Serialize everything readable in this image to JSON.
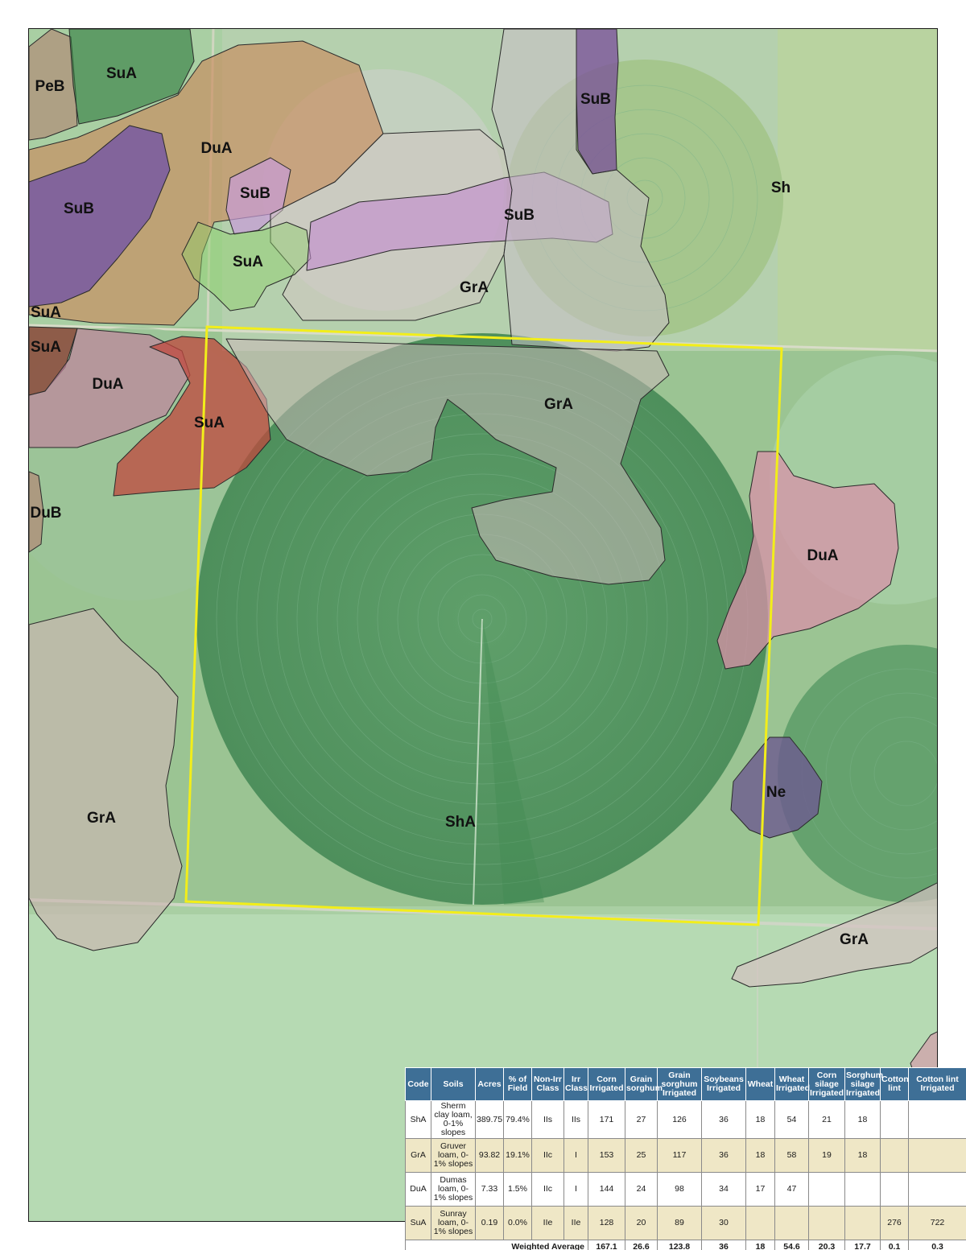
{
  "map": {
    "labels": [
      {
        "key": "PeB",
        "text": "PeB"
      },
      {
        "key": "SuA_1",
        "text": "SuA"
      },
      {
        "key": "SuB_1",
        "text": "SuB"
      },
      {
        "key": "DuA_1",
        "text": "DuA"
      },
      {
        "key": "SuB_2",
        "text": "SuB"
      },
      {
        "key": "SuB_3",
        "text": "SuB"
      },
      {
        "key": "Sh",
        "text": "Sh"
      },
      {
        "key": "SuB_4",
        "text": "SuB"
      },
      {
        "key": "SuA_2",
        "text": "SuA"
      },
      {
        "key": "GrA_1",
        "text": "GrA"
      },
      {
        "key": "SuA_3",
        "text": "SuA"
      },
      {
        "key": "SuA_4",
        "text": "SuA"
      },
      {
        "key": "DuA_2",
        "text": "DuA"
      },
      {
        "key": "SuA_5",
        "text": "SuA"
      },
      {
        "key": "GrA_2",
        "text": "GrA"
      },
      {
        "key": "DuB",
        "text": "DuB"
      },
      {
        "key": "DuA_3",
        "text": "DuA"
      },
      {
        "key": "Ne",
        "text": "Ne"
      },
      {
        "key": "GrA_3",
        "text": "GrA"
      },
      {
        "key": "ShA",
        "text": "ShA"
      },
      {
        "key": "GrA_4",
        "text": "GrA"
      }
    ],
    "colors": {
      "boundary": "#f2ee1a",
      "SuA": "#2f7a3e",
      "SuB": "#8a5aa0",
      "DuA": "#c98a5c",
      "DuA_pink": "#d892a8",
      "GrA": "#c9b8b0",
      "SuA_red": "#c0483e",
      "Ne": "#6d5a90",
      "ShA": "#4f9a5c",
      "PeB": "#b0907a"
    }
  },
  "table": {
    "headers": [
      "Code",
      "Soils",
      "Acres",
      "% of Field",
      "Non-Irr Class",
      "Irr Class",
      "Corn Irrigated",
      "Grain sorghum",
      "Grain sorghum Irrigated",
      "Soybeans Irrigated",
      "Wheat",
      "Wheat Irrigated",
      "Corn silage Irrigated",
      "Sorghum silage Irrigated",
      "Cotton lint",
      "Cotton lint Irrigated"
    ],
    "rows": [
      [
        "ShA",
        "Sherm clay loam, 0-1% slopes",
        "389.75",
        "79.4%",
        "IIs",
        "IIs",
        "171",
        "27",
        "126",
        "36",
        "18",
        "54",
        "21",
        "18",
        "",
        ""
      ],
      [
        "GrA",
        "Gruver loam, 0-1% slopes",
        "93.82",
        "19.1%",
        "IIc",
        "I",
        "153",
        "25",
        "117",
        "36",
        "18",
        "58",
        "19",
        "18",
        "",
        ""
      ],
      [
        "DuA",
        "Dumas loam, 0-1% slopes",
        "7.33",
        "1.5%",
        "IIc",
        "I",
        "144",
        "24",
        "98",
        "34",
        "17",
        "47",
        "",
        "",
        "",
        ""
      ],
      [
        "SuA",
        "Sunray loam, 0-1% slopes",
        "0.19",
        "0.0%",
        "IIe",
        "IIe",
        "128",
        "20",
        "89",
        "30",
        "",
        "",
        "",
        "",
        "276",
        "722"
      ]
    ],
    "weighted_label": "Weighted Average",
    "weighted": [
      "167.1",
      "26.6",
      "123.8",
      "36",
      "18",
      "54.6",
      "20.3",
      "17.7",
      "0.1",
      "0.3"
    ]
  }
}
